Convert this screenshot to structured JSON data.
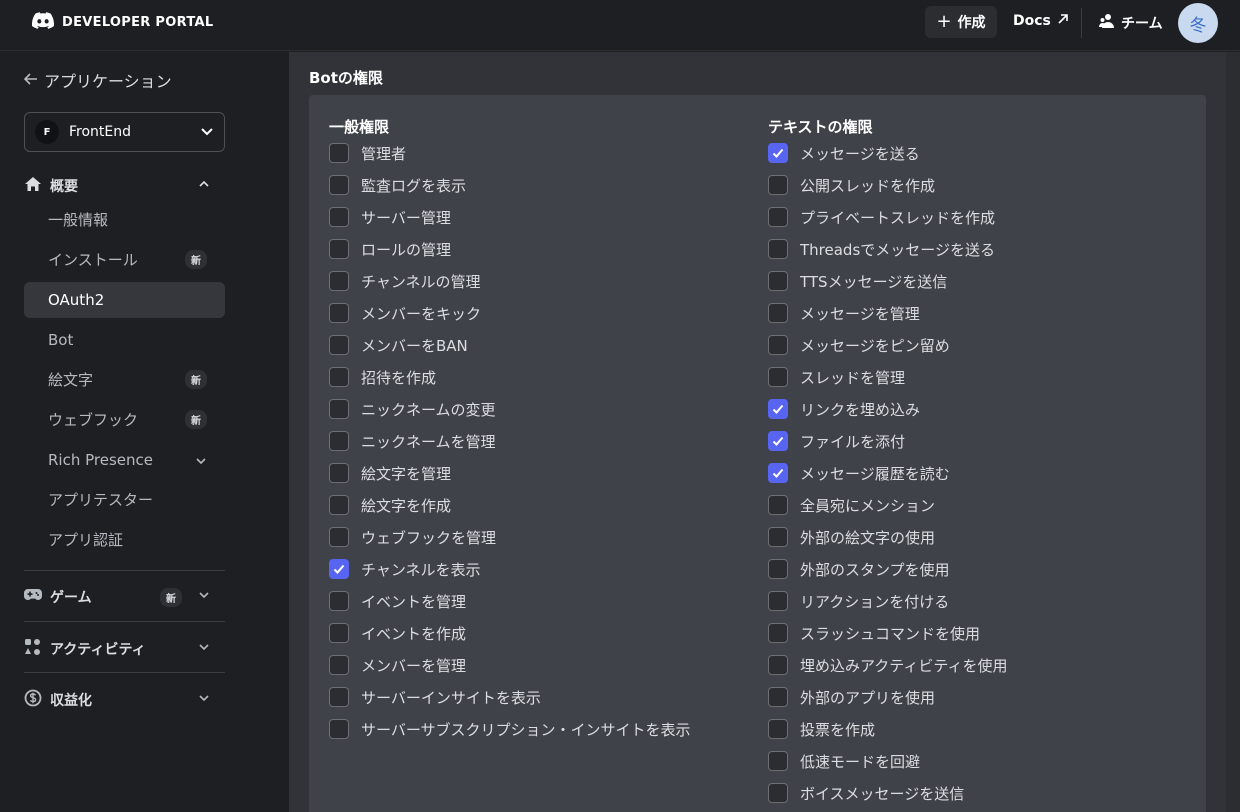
{
  "header": {
    "brand": "DEVELOPER PORTAL",
    "create_label": "作成",
    "docs_label": "Docs",
    "team_label": "チーム",
    "avatar_text": "冬"
  },
  "sidebar": {
    "back_label": "アプリケーション",
    "app_select": {
      "initial": "F",
      "name": "FrontEnd"
    },
    "overview": {
      "label": "概要",
      "items": [
        {
          "label": "一般情報",
          "badge": ""
        },
        {
          "label": "インストール",
          "badge": "新"
        },
        {
          "label": "OAuth2",
          "badge": "",
          "active": true
        },
        {
          "label": "Bot",
          "badge": ""
        },
        {
          "label": "絵文字",
          "badge": "新"
        },
        {
          "label": "ウェブフック",
          "badge": "新"
        },
        {
          "label": "Rich Presence",
          "badge": "",
          "expandable": true
        },
        {
          "label": "アプリテスター",
          "badge": ""
        },
        {
          "label": "アプリ認証",
          "badge": ""
        }
      ]
    },
    "games": {
      "label": "ゲーム",
      "badge": "新"
    },
    "activities": {
      "label": "アクティビティ"
    },
    "monetization": {
      "label": "収益化"
    }
  },
  "main": {
    "title": "Botの権限",
    "general": {
      "heading": "一般権限",
      "items": [
        {
          "label": "管理者",
          "checked": false
        },
        {
          "label": "監査ログを表示",
          "checked": false
        },
        {
          "label": "サーバー管理",
          "checked": false
        },
        {
          "label": "ロールの管理",
          "checked": false
        },
        {
          "label": "チャンネルの管理",
          "checked": false
        },
        {
          "label": "メンバーをキック",
          "checked": false
        },
        {
          "label": "メンバーをBAN",
          "checked": false
        },
        {
          "label": "招待を作成",
          "checked": false
        },
        {
          "label": "ニックネームの変更",
          "checked": false
        },
        {
          "label": "ニックネームを管理",
          "checked": false
        },
        {
          "label": "絵文字を管理",
          "checked": false
        },
        {
          "label": "絵文字を作成",
          "checked": false
        },
        {
          "label": "ウェブフックを管理",
          "checked": false
        },
        {
          "label": "チャンネルを表示",
          "checked": true
        },
        {
          "label": "イベントを管理",
          "checked": false
        },
        {
          "label": "イベントを作成",
          "checked": false
        },
        {
          "label": "メンバーを管理",
          "checked": false
        },
        {
          "label": "サーバーインサイトを表示",
          "checked": false
        },
        {
          "label": "サーバーサブスクリプション・インサイトを表示",
          "checked": false
        }
      ]
    },
    "text": {
      "heading": "テキストの権限",
      "items": [
        {
          "label": "メッセージを送る",
          "checked": true
        },
        {
          "label": "公開スレッドを作成",
          "checked": false
        },
        {
          "label": "プライベートスレッドを作成",
          "checked": false
        },
        {
          "label": "Threadsでメッセージを送る",
          "checked": false
        },
        {
          "label": "TTSメッセージを送信",
          "checked": false
        },
        {
          "label": "メッセージを管理",
          "checked": false
        },
        {
          "label": "メッセージをピン留め",
          "checked": false
        },
        {
          "label": "スレッドを管理",
          "checked": false
        },
        {
          "label": "リンクを埋め込み",
          "checked": true
        },
        {
          "label": "ファイルを添付",
          "checked": true
        },
        {
          "label": "メッセージ履歴を読む",
          "checked": true
        },
        {
          "label": "全員宛にメンション",
          "checked": false
        },
        {
          "label": "外部の絵文字の使用",
          "checked": false
        },
        {
          "label": "外部のスタンプを使用",
          "checked": false
        },
        {
          "label": "リアクションを付ける",
          "checked": false
        },
        {
          "label": "スラッシュコマンドを使用",
          "checked": false
        },
        {
          "label": "埋め込みアクティビティを使用",
          "checked": false
        },
        {
          "label": "外部のアプリを使用",
          "checked": false
        },
        {
          "label": "投票を作成",
          "checked": false
        },
        {
          "label": "低速モードを回避",
          "checked": false
        },
        {
          "label": "ボイスメッセージを送信",
          "checked": false
        }
      ]
    }
  }
}
